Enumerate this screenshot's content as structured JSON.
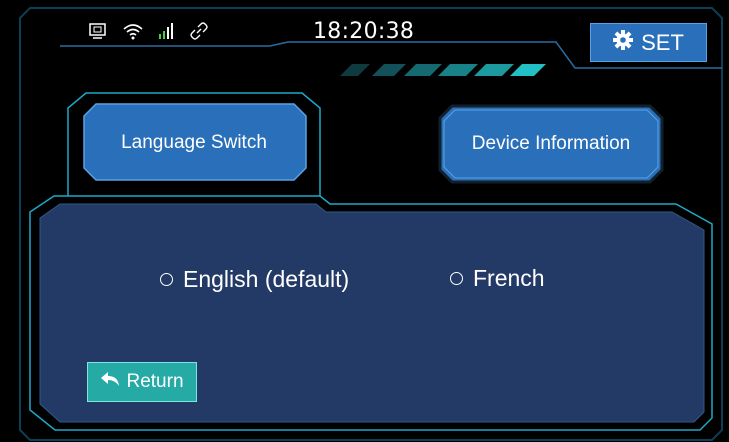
{
  "status_bar": {
    "icons": [
      "screen-icon",
      "wifi-icon",
      "signal-icon",
      "link-icon"
    ],
    "time": "18:20:38"
  },
  "header": {
    "set_label": "SET",
    "set_icon": "gear-icon"
  },
  "tabs": [
    {
      "label": "Language Switch",
      "active": true
    },
    {
      "label": "Device Information",
      "active": false
    }
  ],
  "language": {
    "options": [
      {
        "label": "English (default)",
        "selected": false
      },
      {
        "label": "French",
        "selected": false
      }
    ]
  },
  "footer": {
    "return_label": "Return",
    "return_icon": "reply-arrow-icon"
  },
  "colors": {
    "panel": "#233a66",
    "frame_line": "#1ea8c8",
    "button_blue": "#2a6fba",
    "return_teal": "#25aaa5",
    "stripe": "#1c8a8c"
  }
}
